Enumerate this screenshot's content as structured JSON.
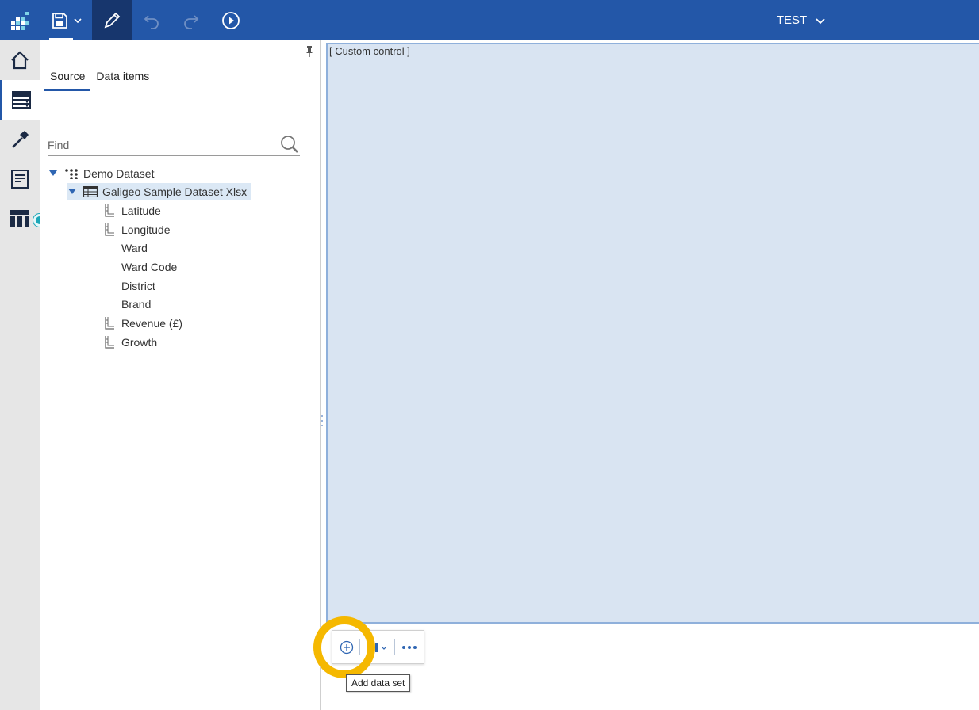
{
  "header": {
    "title": "TEST",
    "icons": [
      "app-logo",
      "save",
      "chevron-down",
      "edit-pencil",
      "undo",
      "redo",
      "play"
    ]
  },
  "nav_rail": {
    "items": [
      {
        "icon": "home-icon",
        "active": false
      },
      {
        "icon": "data-source-icon",
        "active": true
      },
      {
        "icon": "hammer-icon",
        "active": false
      },
      {
        "icon": "page-icon",
        "active": false
      },
      {
        "icon": "table-icon",
        "active": false,
        "has_badge": true
      }
    ]
  },
  "panel": {
    "tabs": [
      {
        "label": "Source",
        "active": true
      },
      {
        "label": "Data items",
        "active": false
      }
    ],
    "search": {
      "placeholder": "Find",
      "value": ""
    },
    "tree": {
      "root": {
        "label": "Demo Dataset",
        "expanded": true
      },
      "dataset": {
        "label": "Galigeo Sample Dataset Xlsx",
        "expanded": true,
        "selected": true
      },
      "items": [
        {
          "label": "Latitude",
          "measure": true
        },
        {
          "label": "Longitude",
          "measure": true
        },
        {
          "label": "Ward",
          "measure": false
        },
        {
          "label": "Ward Code",
          "measure": false
        },
        {
          "label": "District",
          "measure": false
        },
        {
          "label": "Brand",
          "measure": false
        },
        {
          "label": "Revenue (£)",
          "measure": true
        },
        {
          "label": "Growth",
          "measure": true
        }
      ]
    }
  },
  "canvas": {
    "custom_control_label": "[ Custom control ]"
  },
  "floating_toolbar": {
    "tooltip": "Add data set",
    "highlight_color": "#f5b800"
  },
  "colors": {
    "header_bg": "#2357a8",
    "edit_active_bg": "#17366d",
    "control_bg": "#d9e4f2",
    "badge": "#1da7b8"
  }
}
